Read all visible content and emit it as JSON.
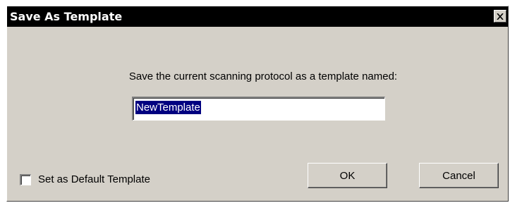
{
  "dialog": {
    "title": "Save As Template",
    "close_icon": "close-icon",
    "prompt": "Save the current scanning protocol as a template named:",
    "template_name": {
      "value": "NewTemplate",
      "selected": true
    },
    "default_checkbox": {
      "label": "Set as Default Template",
      "checked": false
    },
    "ok_label": "OK",
    "cancel_label": "Cancel"
  }
}
